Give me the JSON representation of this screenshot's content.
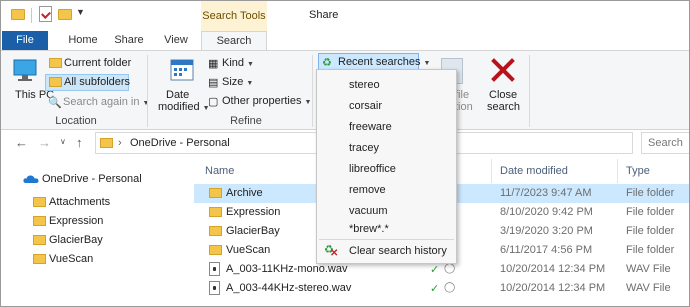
{
  "titlebar": {
    "context_tab": "Search Tools",
    "window_title": "Share"
  },
  "tabs": [
    "File",
    "Home",
    "Share",
    "View",
    "Search"
  ],
  "ribbon": {
    "location": {
      "this_pc": "This PC",
      "current_folder": "Current folder",
      "all_subfolders": "All subfolders",
      "search_again": "Search again in",
      "group_label": "Location"
    },
    "refine": {
      "date_modified_1": "Date",
      "date_modified_2": "modified",
      "kind": "Kind",
      "size": "Size",
      "other_properties": "Other properties",
      "group_label": "Refine"
    },
    "options": {
      "recent_searches": "Recent searches",
      "open_file_1": "file",
      "open_file_2": "tion"
    },
    "close": {
      "label_1": "Close",
      "label_2": "search"
    }
  },
  "address": {
    "path": "OneDrive - Personal",
    "search_placeholder": "Search"
  },
  "navpane": {
    "root": "OneDrive - Personal",
    "folders": [
      "Attachments",
      "Expression",
      "GlacierBay",
      "VueScan"
    ]
  },
  "filelist": {
    "columns": {
      "name": "Name",
      "status": "s",
      "date": "Date modified",
      "type": "Type"
    },
    "rows": [
      {
        "name": "Archive",
        "date": "11/7/2023 9:47 AM",
        "type": "File folder"
      },
      {
        "name": "Expression",
        "date": "8/10/2020 9:42 PM",
        "type": "File folder"
      },
      {
        "name": "GlacierBay",
        "date": "3/19/2020 3:20 PM",
        "type": "File folder"
      },
      {
        "name": "VueScan",
        "date": "6/11/2017 4:56 PM",
        "type": "File folder"
      },
      {
        "name": "A_003-11KHz-mono.wav",
        "date": "10/20/2014 12:34 PM",
        "type": "WAV File"
      },
      {
        "name": "A_003-44KHz-stereo.wav",
        "date": "10/20/2014 12:34 PM",
        "type": "WAV File"
      }
    ]
  },
  "dropdown": {
    "items": [
      "stereo",
      "corsair",
      "freeware",
      "tracey",
      "libreoffice",
      "remove",
      "vacuum",
      "*brew*.*"
    ],
    "clear": "Clear search history"
  },
  "colors": {
    "file_tab": "#1a5fa8",
    "context_tab": "#fdf2d3",
    "selection": "#cce8ff",
    "folder": "#f3c64b",
    "close_x": "#b8121b"
  }
}
